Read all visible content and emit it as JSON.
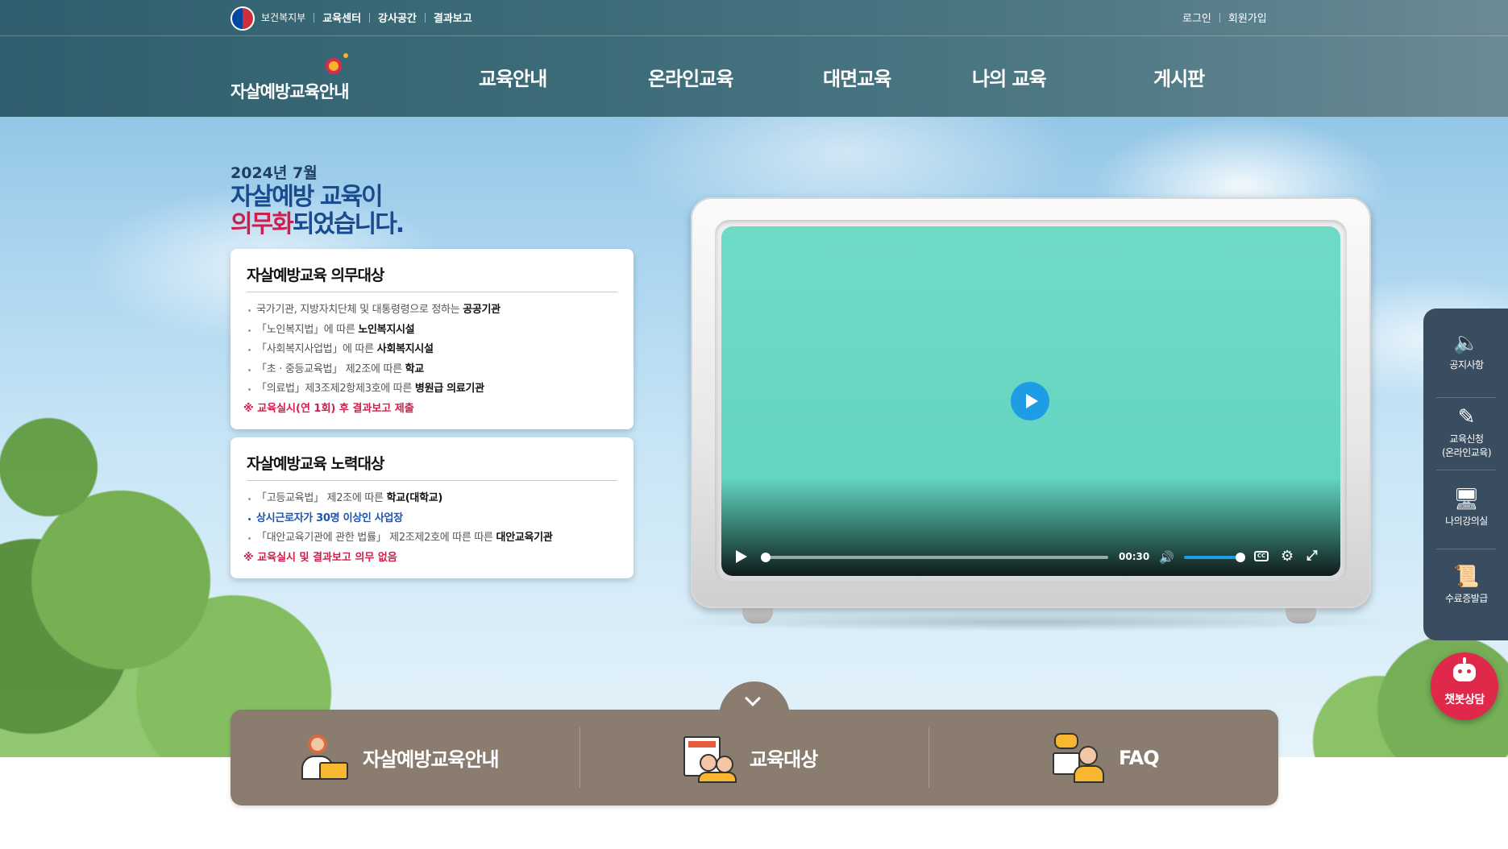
{
  "header": {
    "gov_name": "보건복지부",
    "top_links": [
      "교육센터",
      "강사공간",
      "결과보고"
    ],
    "user_links": [
      "로그인",
      "회원가입"
    ],
    "site_title": "자살예방교육안내",
    "nav": [
      "교육안내",
      "온라인교육",
      "대면교육",
      "나의 교육",
      "게시판"
    ]
  },
  "hero": {
    "date": "2024년 7월",
    "title_line1": "자살예방 교육이",
    "title_line2_red": "의무화",
    "title_line2_rest": "되었습니다."
  },
  "card_mandatory": {
    "title": "자살예방교육 의무대상",
    "items": [
      {
        "pre": "국가기관, 지방자치단체 및 대통령령으로 정하는 ",
        "bold": "공공기관"
      },
      {
        "pre": "「노인복지법」에 따른 ",
        "bold": "노인복지시설"
      },
      {
        "pre": "「사회복지사업법」에 따른 ",
        "bold": "사회복지시설"
      },
      {
        "pre": "「초 · 중등교육법」 제2조에 따른 ",
        "bold": "학교"
      },
      {
        "pre": "「의료법」제3조제2항제3호에 따른 ",
        "bold": "병원급 의료기관"
      }
    ],
    "note": "※ 교육실시(연 1회) 후 결과보고 제출"
  },
  "card_effort": {
    "title": "자살예방교육 노력대상",
    "items": [
      {
        "pre": "「고등교육법」 제2조에 따른 ",
        "bold": "학교(대학교)"
      },
      {
        "pre": "상시근로자가 30명 이상인 사업장",
        "bold": ""
      },
      {
        "pre": "「대안교육기관에 관한 법률」 제2조제2호에 따른 따른 ",
        "bold": "대안교육기관"
      }
    ],
    "note": "※ 교육실시 및 결과보고 의무 없음"
  },
  "video": {
    "time": "00:30",
    "progress": 0.0,
    "volume": 1.0,
    "screen_color": "#6fdbc7",
    "accent_color": "#1e9de6"
  },
  "quick_menu": [
    {
      "icon": "speaker-icon",
      "label": "공지사항"
    },
    {
      "icon": "edit-icon",
      "label_line1": "교육신청",
      "label_line2": "(온라인교육)"
    },
    {
      "icon": "monitor-icon",
      "label": "나의강의실"
    },
    {
      "icon": "certificate-icon",
      "label": "수료증발급"
    }
  ],
  "chatbot": {
    "label": "챗봇상담",
    "color": "#e0284b"
  },
  "bottom_bar": {
    "color": "#8a7d70",
    "items": [
      "자살예방교육안내",
      "교육대상",
      "FAQ"
    ]
  }
}
